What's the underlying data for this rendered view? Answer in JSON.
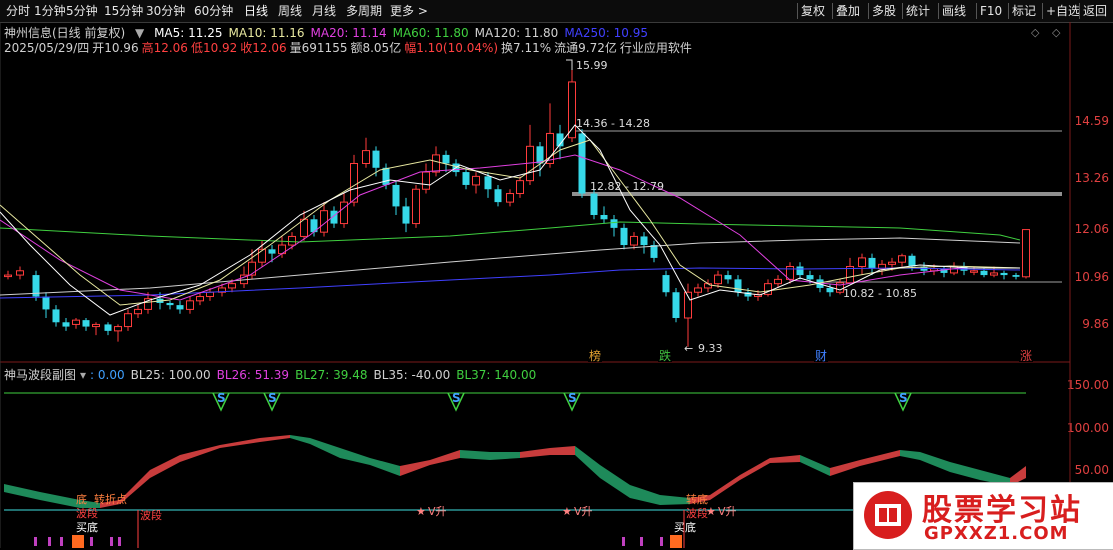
{
  "toolbar": {
    "periods": [
      "分时",
      "1分钟",
      "5分钟",
      "15分钟",
      "30分钟",
      "60分钟",
      "日线",
      "周线",
      "月线",
      "多周期",
      "更多 >"
    ],
    "right_buttons": [
      "复权",
      "叠加",
      "多股",
      "统计",
      "画线",
      "F10",
      "标记",
      "+自选",
      "返回"
    ]
  },
  "stock": {
    "title": "神州信息(日线 前复权)",
    "ma": [
      {
        "label": "MA5: 11.25",
        "color": "#ffffff"
      },
      {
        "label": "MA10: 11.16",
        "color": "#e8e8a0"
      },
      {
        "label": "MA20: 11.14",
        "color": "#e040e0"
      },
      {
        "label": "MA60: 11.80",
        "color": "#40d040"
      },
      {
        "label": "MA120: 11.80",
        "color": "#d0d0d0"
      },
      {
        "label": "MA250: 10.95",
        "color": "#4040ff"
      }
    ],
    "info": [
      {
        "text": "2025/05/29/四",
        "color": "#d0d0d0"
      },
      {
        "text": "开10.96",
        "color": "#d0d0d0"
      },
      {
        "text": "高12.06",
        "color": "#ff4040"
      },
      {
        "text": "低10.92",
        "color": "#ff4040"
      },
      {
        "text": "收12.06",
        "color": "#ff4040"
      },
      {
        "text": "量691155",
        "color": "#d0d0d0"
      },
      {
        "text": "额8.05亿",
        "color": "#d0d0d0"
      },
      {
        "text": "幅1.10(10.04%)",
        "color": "#ff4040"
      },
      {
        "text": "换7.11%",
        "color": "#d0d0d0"
      },
      {
        "text": "流通9.72亿",
        "color": "#d0d0d0"
      },
      {
        "text": "行业应用软件",
        "color": "#d0d0d0"
      }
    ],
    "price_axis": [
      "14.59",
      "13.26",
      "12.06",
      "10.96",
      "9.86"
    ],
    "annotations": {
      "high": "15.99",
      "low": "9.33",
      "range1": "14.36 - 14.28",
      "range2": "12.82 - 12.79",
      "range3": "10.82 - 10.85"
    },
    "tags": [
      {
        "text": "榜",
        "color": "#e0a030"
      },
      {
        "text": "跌",
        "color": "#40c040"
      },
      {
        "text": "财",
        "color": "#4080ff"
      },
      {
        "text": "涨",
        "color": "#e04040"
      }
    ]
  },
  "indicator": {
    "title": "神马波段副图",
    "values": [
      {
        "text": ": 0.00",
        "color": "#40a0ff"
      },
      {
        "text": "BL25: 100.00",
        "color": "#d0d0d0"
      },
      {
        "text": "BL26: 51.39",
        "color": "#e040e0"
      },
      {
        "text": "BL27: 39.48",
        "color": "#40d040"
      },
      {
        "text": "BL35: -40.00",
        "color": "#d0d0d0"
      },
      {
        "text": "BL37: 140.00",
        "color": "#40d040"
      }
    ],
    "axis": [
      "150.00",
      "100.00",
      "50.00"
    ],
    "s_marker": "S",
    "signals": {
      "bottom": "底",
      "turn": "转折点",
      "wave": "波段",
      "buy_bottom": "买底",
      "v_up": "V升",
      "rise": "转底"
    }
  },
  "watermark": {
    "title": "股票学习站",
    "url": "GPXXZ1.COM"
  },
  "colors": {
    "up": "#ff3c3c",
    "down": "#36d8e8",
    "cyan_line": "#40e0e0"
  }
}
